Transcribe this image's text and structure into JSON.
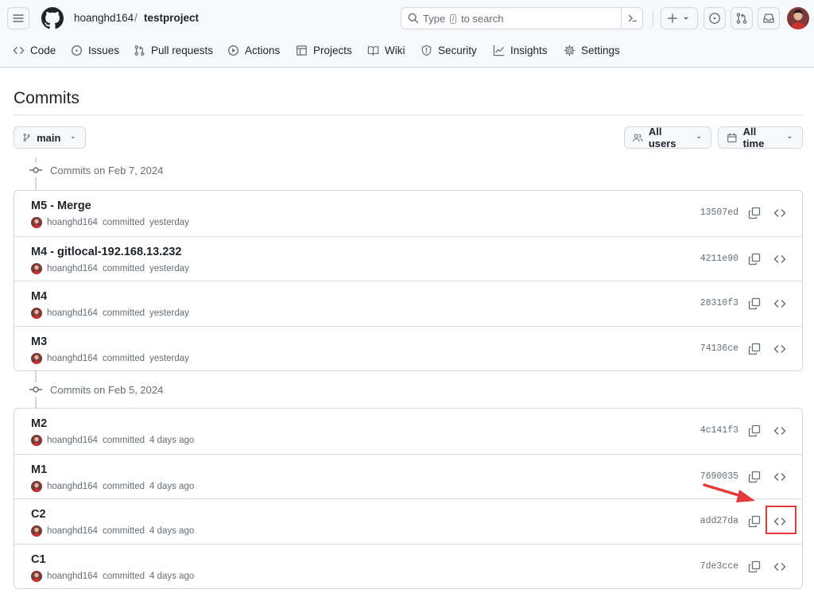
{
  "header": {
    "owner": "hoanghd164",
    "separator": "/",
    "repo": "testproject",
    "search_prefix": "Type",
    "search_key": "/",
    "search_suffix": "to search"
  },
  "nav": [
    {
      "label": "Code",
      "icon": "code-icon"
    },
    {
      "label": "Issues",
      "icon": "issue-icon"
    },
    {
      "label": "Pull requests",
      "icon": "pull-request-icon"
    },
    {
      "label": "Actions",
      "icon": "play-icon"
    },
    {
      "label": "Projects",
      "icon": "table-icon"
    },
    {
      "label": "Wiki",
      "icon": "book-icon"
    },
    {
      "label": "Security",
      "icon": "shield-icon"
    },
    {
      "label": "Insights",
      "icon": "graph-icon"
    },
    {
      "label": "Settings",
      "icon": "gear-icon"
    }
  ],
  "page": {
    "title": "Commits",
    "branch": "main",
    "users_filter": "All users",
    "time_filter": "All time"
  },
  "groups": [
    {
      "label": "Commits on Feb 7, 2024",
      "commits": [
        {
          "message": "M5 - Merge",
          "author": "hoanghd164",
          "action": "committed",
          "when": "yesterday",
          "sha": "13507ed"
        },
        {
          "message": "M4 - gitlocal-192.168.13.232",
          "author": "hoanghd164",
          "action": "committed",
          "when": "yesterday",
          "sha": "4211e90"
        },
        {
          "message": "M4",
          "author": "hoanghd164",
          "action": "committed",
          "when": "yesterday",
          "sha": "28310f3"
        },
        {
          "message": "M3",
          "author": "hoanghd164",
          "action": "committed",
          "when": "yesterday",
          "sha": "74136ce"
        }
      ]
    },
    {
      "label": "Commits on Feb 5, 2024",
      "commits": [
        {
          "message": "M2",
          "author": "hoanghd164",
          "action": "committed",
          "when": "4 days ago",
          "sha": "4c141f3"
        },
        {
          "message": "M1",
          "author": "hoanghd164",
          "action": "committed",
          "when": "4 days ago",
          "sha": "7690035"
        },
        {
          "message": "C2",
          "author": "hoanghd164",
          "action": "committed",
          "when": "4 days ago",
          "sha": "add27da"
        },
        {
          "message": "C1",
          "author": "hoanghd164",
          "action": "committed",
          "when": "4 days ago",
          "sha": "7de3cce"
        }
      ]
    }
  ],
  "colors": {
    "annotation": "#e5383b",
    "muted_text": "#656d76",
    "border": "#d0d7de",
    "header_bg": "#f6f8fa"
  }
}
